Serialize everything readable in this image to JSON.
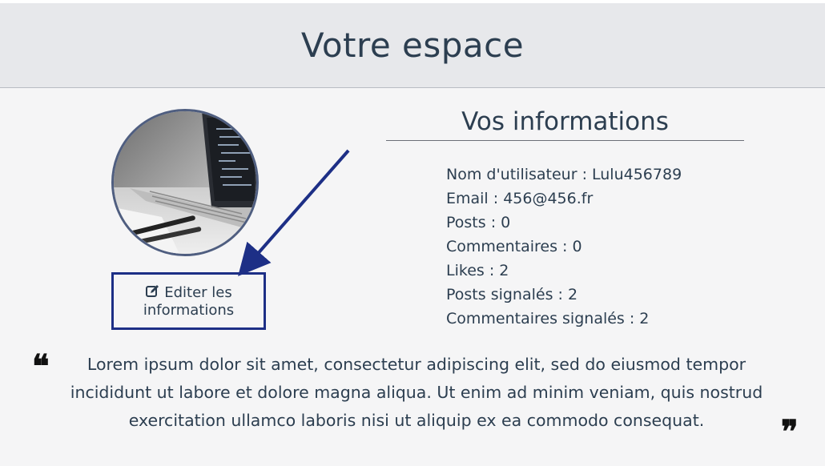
{
  "header": {
    "title": "Votre espace"
  },
  "profile": {
    "edit_label": "Editer les informations"
  },
  "info": {
    "title": "Vos informations",
    "items": [
      "Nom d'utilisateur : Lulu456789",
      "Email : 456@456.fr",
      "Posts : 0",
      "Commentaires : 0",
      "Likes : 2",
      "Posts signalés : 2",
      "Commentaires signalés : 2"
    ]
  },
  "quote": {
    "open_mark": "❝",
    "close_mark": "❞",
    "text": "Lorem ipsum dolor sit amet, consectetur adipiscing elit, sed do eiusmod tempor incididunt ut labore et dolore magna aliqua. Ut enim ad minim veniam, quis nostrud exercitation ullamco laboris nisi ut aliquip ex ea commodo consequat."
  },
  "colors": {
    "header_bg": "#e7e8eb",
    "page_bg": "#f5f5f6",
    "text": "#2c3e50",
    "annotation_blue": "#1d2f86",
    "avatar_border": "#4f5e80"
  },
  "icons": {
    "edit": "edit-icon",
    "quote_open": "quote-open-icon",
    "quote_close": "quote-close-icon"
  }
}
